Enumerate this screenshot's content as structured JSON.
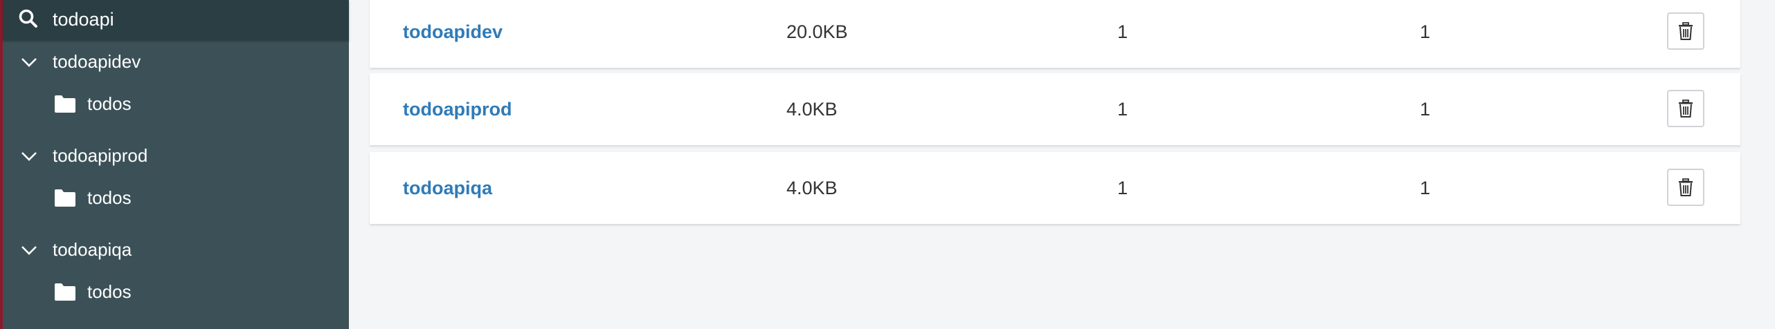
{
  "sidebar": {
    "search": {
      "value": "todoapi",
      "icon": "search-icon"
    },
    "databases": [
      {
        "name": "todoapidev",
        "collections": [
          {
            "name": "todos"
          }
        ]
      },
      {
        "name": "todoapiprod",
        "collections": [
          {
            "name": "todos"
          }
        ]
      },
      {
        "name": "todoapiqa",
        "collections": [
          {
            "name": "todos"
          }
        ]
      }
    ]
  },
  "main": {
    "rows": [
      {
        "name": "todoapidev",
        "size": "20.0KB",
        "col_a": "1",
        "col_b": "1"
      },
      {
        "name": "todoapiprod",
        "size": "4.0KB",
        "col_a": "1",
        "col_b": "1"
      },
      {
        "name": "todoapiqa",
        "size": "4.0KB",
        "col_a": "1",
        "col_b": "1"
      }
    ]
  },
  "colors": {
    "sidebar_bg": "#3c5157",
    "search_bg": "#2b3e44",
    "accent_link": "#2f7bb8",
    "page_bg": "#f4f5f7"
  }
}
